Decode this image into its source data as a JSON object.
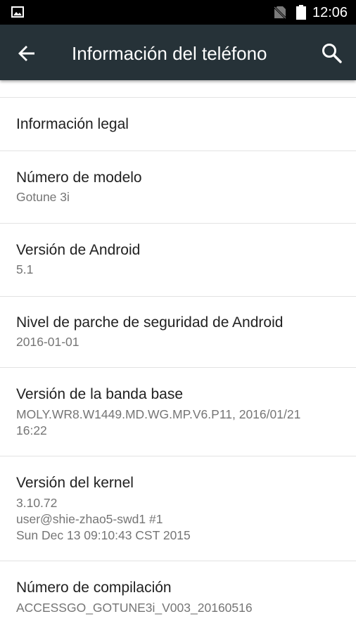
{
  "status_bar": {
    "time": "12:06",
    "icons": [
      "image-notification-icon",
      "no-sim-icon",
      "battery-icon"
    ]
  },
  "app_bar": {
    "title": "Información del teléfono",
    "background": "#263238",
    "back_icon": "arrow-back-icon",
    "search_icon": "search-icon"
  },
  "items": [
    {
      "title": "Información legal",
      "summary": ""
    },
    {
      "title": "Número de modelo",
      "summary": "Gotune 3i"
    },
    {
      "title": "Versión de Android",
      "summary": "5.1"
    },
    {
      "title": "Nivel de parche de seguridad de Android",
      "summary": "2016-01-01"
    },
    {
      "title": "Versión de la banda base",
      "summary": "MOLY.WR8.W1449.MD.WG.MP.V6.P11, 2016/01/21\n16:22"
    },
    {
      "title": "Versión del kernel",
      "summary": "3.10.72\nuser@shie-zhao5-swd1 #1\nSun Dec 13 09:10:43 CST 2015"
    },
    {
      "title": "Número de compilación",
      "summary": "ACCESSGO_GOTUNE3i_V003_20160516"
    }
  ]
}
